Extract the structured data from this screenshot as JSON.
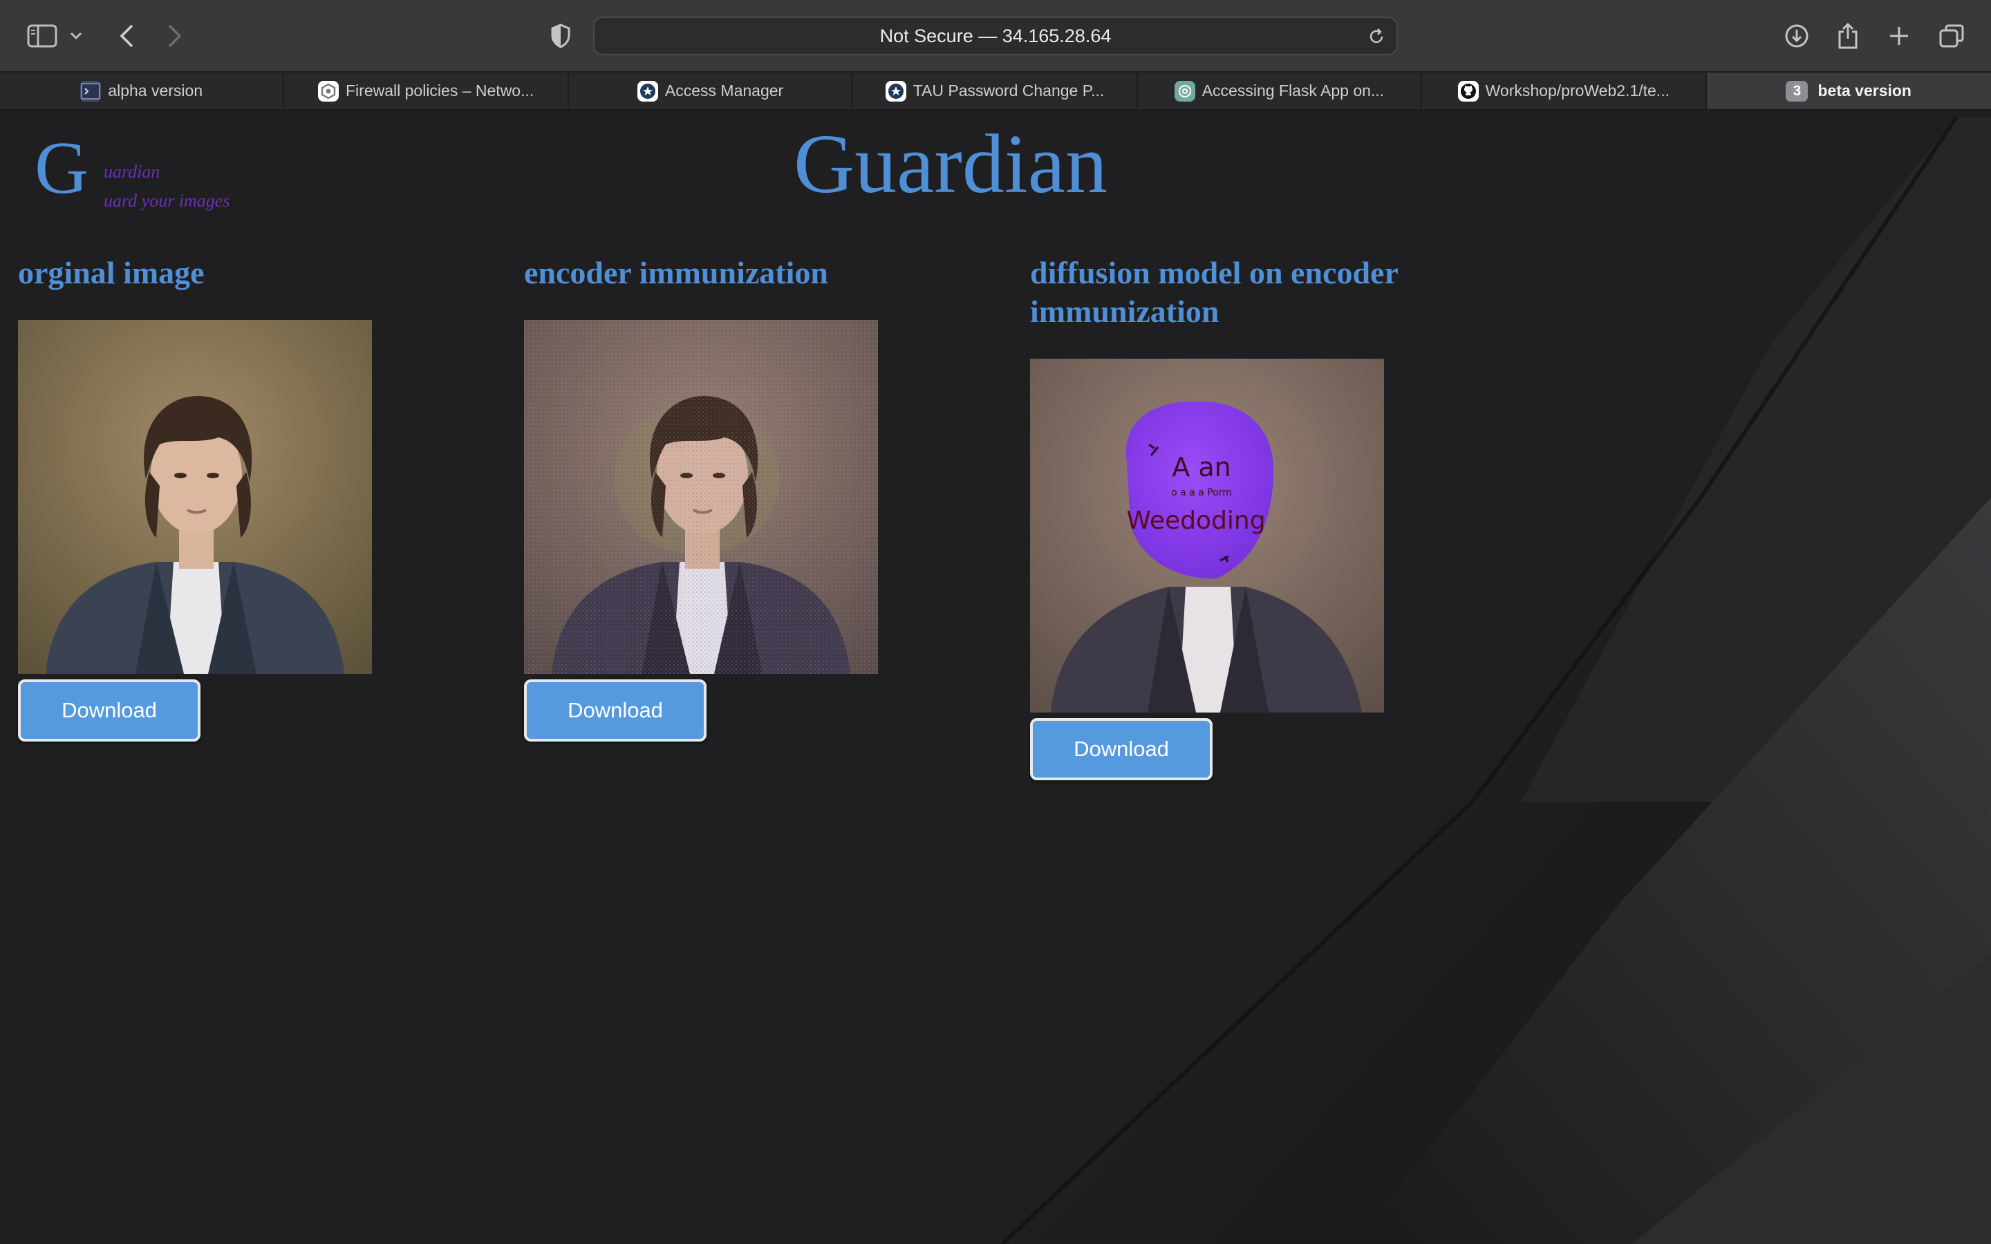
{
  "browser": {
    "url": "Not Secure — 34.165.28.64",
    "tabs": [
      {
        "label": "alpha version",
        "icon": "terminal-favicon-icon"
      },
      {
        "label": "Firewall policies – Netwo...",
        "icon": "gcp-favicon-icon"
      },
      {
        "label": "Access Manager",
        "icon": "access-manager-favicon-icon"
      },
      {
        "label": "TAU Password Change P...",
        "icon": "tau-favicon-icon"
      },
      {
        "label": "Accessing Flask App on...",
        "icon": "chatgpt-favicon-icon"
      },
      {
        "label": "Workshop/proWeb2.1/te...",
        "icon": "github-favicon-icon"
      },
      {
        "label": "beta version",
        "count": "3",
        "active": true
      }
    ]
  },
  "logo": {
    "letter": "G",
    "line1": "uardian",
    "line2": "uard your images"
  },
  "site_title": "Guardian",
  "columns": [
    {
      "title": "orginal image",
      "button": "Download"
    },
    {
      "title": "encoder immunization",
      "button": "Download"
    },
    {
      "title": "diffusion model on encoder immunization",
      "button": "Download"
    }
  ],
  "generated_overlay": {
    "line1": "A an",
    "line2": "o a a a Porm",
    "line3": "Weedoding"
  },
  "colors": {
    "accent_blue": "#4f8fd6",
    "button_blue": "#559ade",
    "logo_purple": "#6a2fb8",
    "overlay_purple": "#8b3ff0"
  }
}
